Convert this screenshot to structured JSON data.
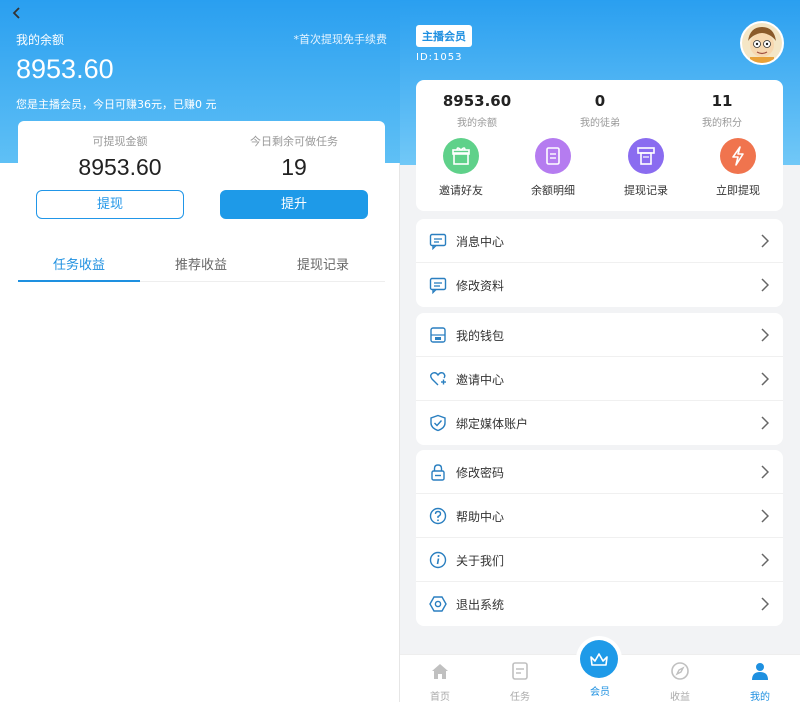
{
  "left": {
    "title": "我的余额",
    "fee_note": "*首次提现免手续费",
    "balance": "8953.60",
    "info": "您是主播会员，今日可赚36元，已赚0 元",
    "withdrawable_label": "可提现金额",
    "withdrawable_value": "8953.60",
    "tasks_label": "今日剩余可做任务",
    "tasks_value": "19",
    "withdraw_btn": "提现",
    "upgrade_btn": "提升",
    "tabs": [
      "任务收益",
      "推荐收益",
      "提现记录"
    ]
  },
  "right": {
    "member_badge": "主播会员",
    "user_id": "ID:1053",
    "stats": [
      {
        "value": "8953.60",
        "label": "我的余额"
      },
      {
        "value": "0",
        "label": "我的徒弟"
      },
      {
        "value": "11",
        "label": "我的积分"
      }
    ],
    "quick": [
      {
        "label": "邀请好友",
        "icon": "gift-icon",
        "color": "#5fd18a"
      },
      {
        "label": "余额明细",
        "icon": "document-icon",
        "color": "#b57cf0"
      },
      {
        "label": "提现记录",
        "icon": "receipt-icon",
        "color": "#8a6cf0"
      },
      {
        "label": "立即提现",
        "icon": "lightning-icon",
        "color": "#f0744e"
      }
    ],
    "menu_group1": [
      {
        "label": "消息中心",
        "icon": "message-icon"
      },
      {
        "label": "修改资料",
        "icon": "edit-profile-icon"
      }
    ],
    "menu_group2": [
      {
        "label": "我的钱包",
        "icon": "wallet-icon"
      },
      {
        "label": "邀请中心",
        "icon": "heart-plus-icon"
      },
      {
        "label": "绑定媒体账户",
        "icon": "shield-check-icon"
      }
    ],
    "menu_group3": [
      {
        "label": "修改密码",
        "icon": "lock-icon"
      },
      {
        "label": "帮助中心",
        "icon": "question-icon"
      },
      {
        "label": "关于我们",
        "icon": "info-icon"
      },
      {
        "label": "退出系统",
        "icon": "logout-icon"
      }
    ],
    "nav": [
      "首页",
      "任务",
      "会员",
      "收益",
      "我的"
    ],
    "colors": {
      "accent": "#1e90e0",
      "icon_stroke": "#2a7fc0"
    }
  }
}
